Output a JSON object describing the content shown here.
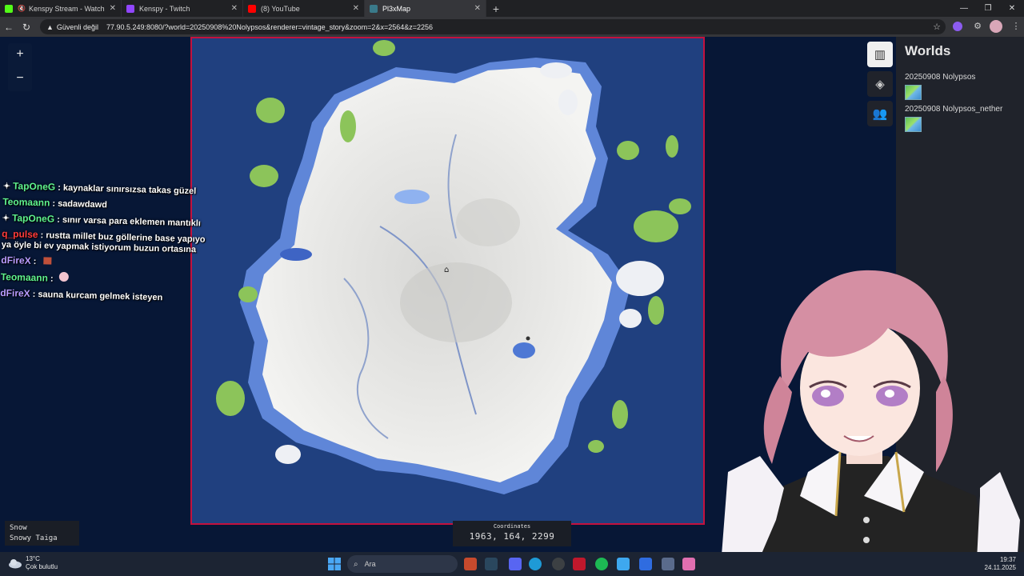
{
  "browser": {
    "tabs": [
      {
        "label": "Kenspy Stream - Watch Live",
        "favicon_color": "#53fc18",
        "muted": true,
        "active": false
      },
      {
        "label": "Kenspy - Twitch",
        "favicon_color": "#9146ff",
        "muted": false,
        "active": false
      },
      {
        "label": "(8) YouTube",
        "favicon_color": "#ff0000",
        "muted": false,
        "active": false
      },
      {
        "label": "Pl3xMap",
        "favicon_color": "#3a7a8a",
        "muted": false,
        "active": true
      }
    ],
    "security_label": "Güvenli değil",
    "url": "77.90.5.249:8080/?world=20250908%20Nolypsos&renderer=vintage_story&zoom=2&x=2564&z=2256"
  },
  "map": {
    "zoom_in": "+",
    "zoom_out": "−"
  },
  "sidebar": {
    "title": "Worlds",
    "worlds": [
      {
        "name": "20250908 Nolypsos"
      },
      {
        "name": "20250908 Nolypsos_nether"
      }
    ],
    "icons": [
      "map-icon",
      "layers-icon",
      "players-icon"
    ]
  },
  "chat": [
    {
      "user": "TapOneG",
      "user_color": "#5ff38f",
      "message": ": kaynaklar sınırsızsa takas güzel",
      "badge": true
    },
    {
      "user": "Teomaann",
      "user_color": "#5ff38f",
      "message": ": sadawdawd",
      "badge": false
    },
    {
      "user": "TapOneG",
      "user_color": "#5ff38f",
      "message": ": sınır varsa para eklemen mantıklı",
      "badge": true
    },
    {
      "user": "q_pulse",
      "user_color": "#ff3b3b",
      "message": ": rustta millet buz göllerine base yapıyo",
      "badge": false
    },
    {
      "user": "",
      "user_color": "#ffffff",
      "message": "ya öyle bi ev yapmak istiyorum buzun ortasına",
      "badge": false
    },
    {
      "user": "dFireX",
      "user_color": "#b99cff",
      "message": ":",
      "badge": false
    },
    {
      "user": "Teomaann",
      "user_color": "#5ff38f",
      "message": ":",
      "badge": false
    },
    {
      "user": "dFireX",
      "user_color": "#b99cff",
      "message": ": sauna kurcam gelmek isteyen",
      "badge": false
    }
  ],
  "biome": {
    "line1": "Snow",
    "line2": "Snowy Taiga"
  },
  "coordinates": {
    "title": "Coordinates",
    "value": "1963, 164, 2299"
  },
  "taskbar": {
    "temperature": "13°C",
    "weather": "Çok bulutlu",
    "search_placeholder": "Ara",
    "time": "19:37",
    "date": "24.11.2025"
  }
}
